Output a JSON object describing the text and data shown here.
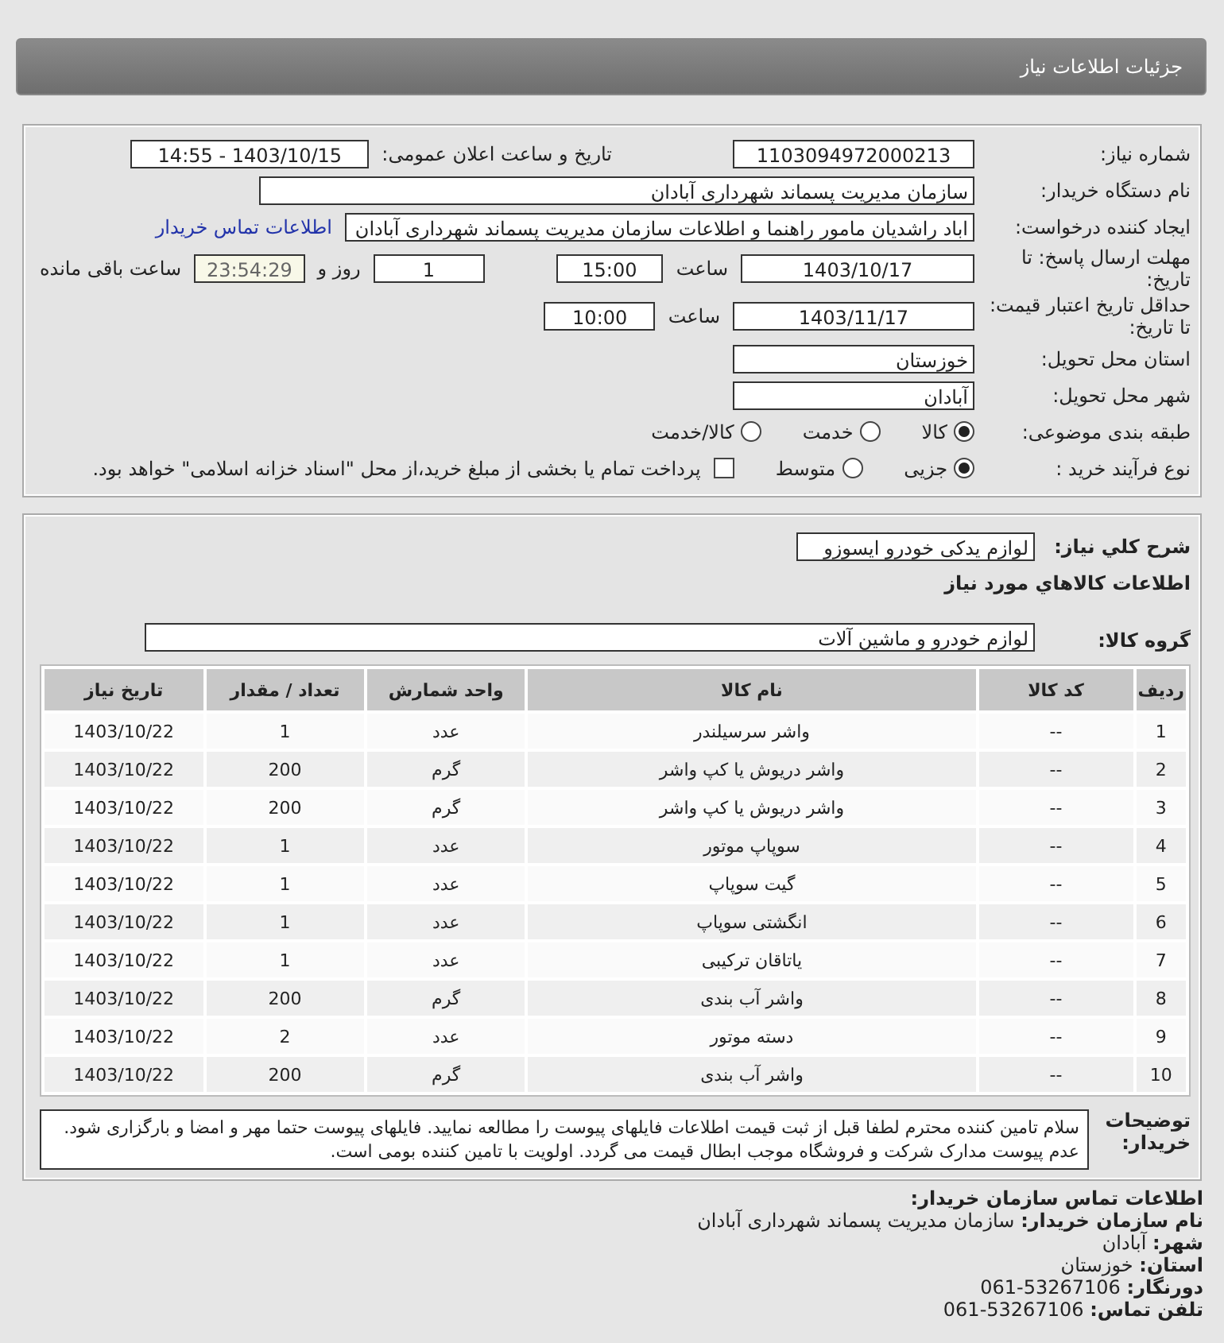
{
  "header": {
    "title": "جزئیات اطلاعات نیاز"
  },
  "need_number": {
    "label": "شماره نیاز:",
    "value": "1103094972000213"
  },
  "announce": {
    "label": "تاریخ و ساعت اعلان عمومی:",
    "value": "1403/10/15 - 14:55"
  },
  "buyer": {
    "label": "نام دستگاه خریدار:",
    "value": "سازمان مدیریت پسماند شهرداری آبادان"
  },
  "requester": {
    "label": "ایجاد کننده درخواست:",
    "value": "اباد راشدیان مامور راهنما و اطلاعات سازمان مدیریت پسماند شهرداری آبادان",
    "link": "اطلاعات تماس خریدار"
  },
  "deadline": {
    "label": "مهلت ارسال پاسخ: تا تاریخ:",
    "date": "1403/10/17",
    "time_label": "ساعت",
    "time": "15:00",
    "days": "1",
    "days_label": "روز و",
    "remaining": "23:54:29",
    "remaining_label": "ساعت باقی مانده"
  },
  "validity": {
    "label": "حداقل تاریخ اعتبار قیمت: تا تاریخ:",
    "date": "1403/11/17",
    "time_label": "ساعت",
    "time": "10:00"
  },
  "province": {
    "label": "استان محل تحویل:",
    "value": "خوزستان"
  },
  "city": {
    "label": "شهر محل تحویل:",
    "value": "آبادان"
  },
  "category": {
    "label": "طبقه بندی موضوعی:",
    "options": [
      {
        "label": "کالا",
        "selected": true
      },
      {
        "label": "خدمت",
        "selected": false
      },
      {
        "label": "کالا/خدمت",
        "selected": false
      }
    ]
  },
  "process": {
    "label": "نوع فرآیند خرید :",
    "options": [
      {
        "label": "جزیی",
        "selected": true
      },
      {
        "label": "متوسط",
        "selected": false
      }
    ],
    "treasury": {
      "checked": false,
      "label": "پرداخت تمام یا بخشی از مبلغ خرید،از محل \"اسناد خزانه اسلامی\" خواهد بود."
    }
  },
  "summary": {
    "label": "شرح كلي نياز:",
    "value": "لوازم یدکی خودرو ایسوزو"
  },
  "items_heading": "اطلاعات كالاهاي مورد نياز",
  "group": {
    "label": "گروه کالا:",
    "value": "لوازم خودرو و ماشین آلات"
  },
  "table": {
    "columns": [
      "ردیف",
      "کد کالا",
      "نام کالا",
      "واحد شمارش",
      "تعداد / مقدار",
      "تاریخ نیاز"
    ],
    "rows": [
      [
        "1",
        "--",
        "واشر سرسیلندر",
        "عدد",
        "1",
        "1403/10/22"
      ],
      [
        "2",
        "--",
        "واشر دریوش یا کپ واشر",
        "گرم",
        "200",
        "1403/10/22"
      ],
      [
        "3",
        "--",
        "واشر دریوش یا کپ واشر",
        "گرم",
        "200",
        "1403/10/22"
      ],
      [
        "4",
        "--",
        "سوپاپ موتور",
        "عدد",
        "1",
        "1403/10/22"
      ],
      [
        "5",
        "--",
        "گیت سوپاپ",
        "عدد",
        "1",
        "1403/10/22"
      ],
      [
        "6",
        "--",
        "انگشتی سوپاپ",
        "عدد",
        "1",
        "1403/10/22"
      ],
      [
        "7",
        "--",
        "یاتاقان ترکیبی",
        "عدد",
        "1",
        "1403/10/22"
      ],
      [
        "8",
        "--",
        "واشر آب بندی",
        "گرم",
        "200",
        "1403/10/22"
      ],
      [
        "9",
        "--",
        "دسته موتور",
        "عدد",
        "2",
        "1403/10/22"
      ],
      [
        "10",
        "--",
        "واشر آب بندی",
        "گرم",
        "200",
        "1403/10/22"
      ]
    ]
  },
  "notes": {
    "label": "توضیحات خریدار:",
    "text": "سلام تامین کننده محترم لطفا قبل از ثبت قیمت اطلاعات فایلهای پیوست را مطالعه نمایید. فایلهای پیوست حتما مهر و امضا و بارگزاری شود. عدم پیوست مدارک شرکت و فروشگاه موجب ابطال قیمت می گردد. اولویت با تامین کننده بومی است."
  },
  "contact": {
    "heading": "اطلاعات تماس سازمان خریدار:",
    "lines": [
      {
        "label": "نام سازمان خریدار:",
        "value": "سازمان مدیریت پسماند شهرداری آبادان"
      },
      {
        "label": "شهر:",
        "value": "آبادان"
      },
      {
        "label": "استان:",
        "value": "خوزستان"
      },
      {
        "label": "دورنگار:",
        "value": "53267106-061"
      },
      {
        "label": "تلفن تماس:",
        "value": "53267106-061"
      }
    ]
  }
}
